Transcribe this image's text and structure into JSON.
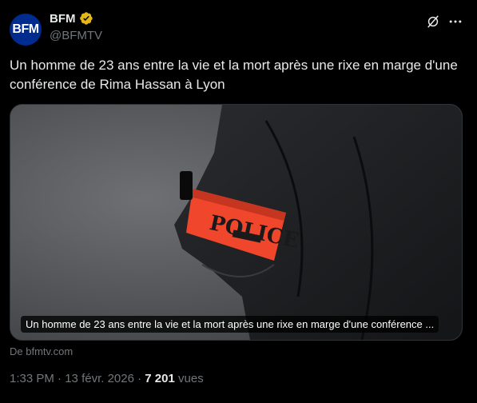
{
  "author": {
    "avatar_text": "BFM",
    "display_name": "BFM",
    "handle": "@BFMTV",
    "verified_color": "#e2b719",
    "avatar_color": "#002b8f"
  },
  "tweet": {
    "text": "Un homme de 23 ans entre la vie et la mort après une rixe en marge d'une conférence de Rima Hassan à Lyon"
  },
  "card": {
    "title": "Un homme de 23 ans entre la vie et la mort après une rixe en marge d'une conférence ...",
    "source": "De bfmtv.com",
    "armband_text": "POLICE",
    "armband_color": "#f0462b"
  },
  "meta": {
    "time": "1:33 PM",
    "separator": "·",
    "date": "13 févr. 2026",
    "views_count": "7 201",
    "views_label": "vues"
  },
  "icons": {
    "grok": "grok-icon",
    "more": "more-dots-icon",
    "verified": "verified-badge-icon"
  }
}
